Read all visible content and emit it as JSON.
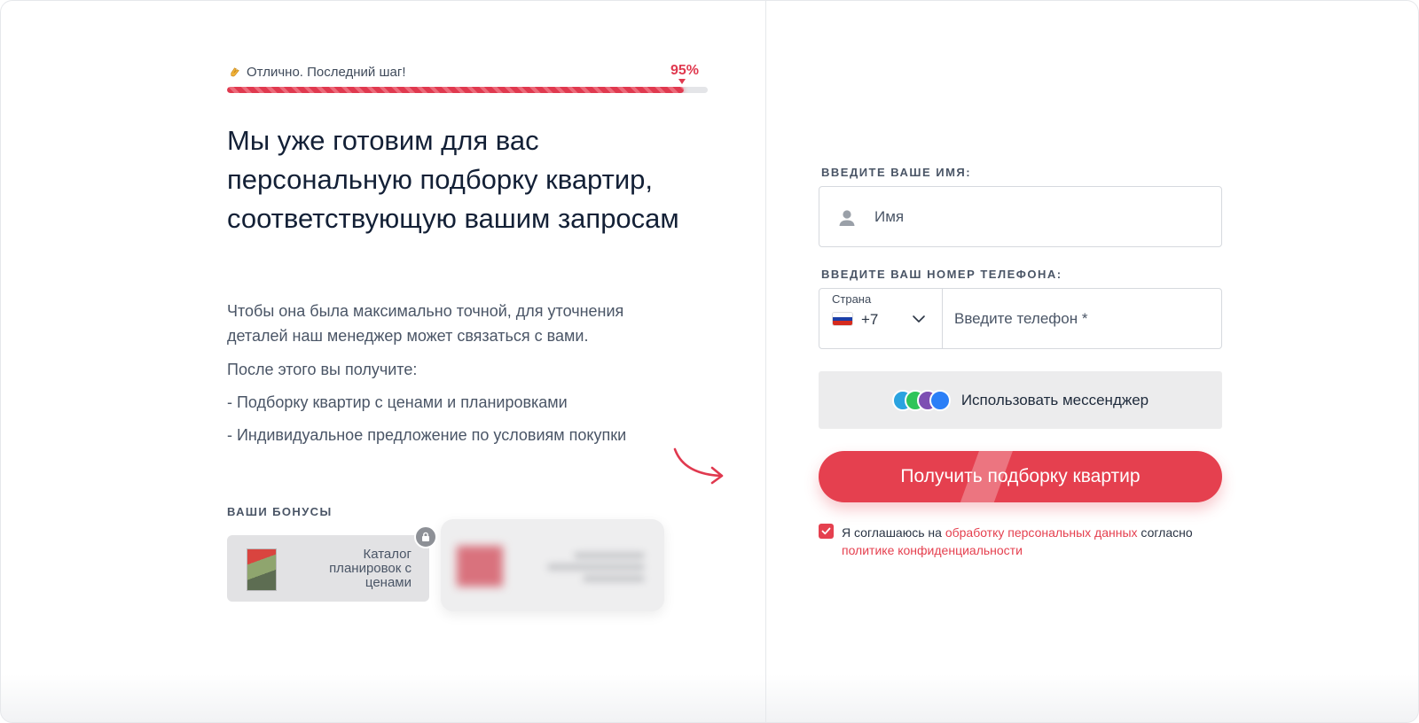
{
  "progress": {
    "text": "Отлично. Последний шаг!",
    "percent_label": "95%",
    "value": 0.95,
    "icon": "clap-icon"
  },
  "left": {
    "headline": "Мы уже готовим для вас персональную подборку квартир, соответствующую вашим запросам",
    "paragraph1": "Чтобы она была максимально точной, для уточнения деталей наш менеджер может связаться с вами.",
    "paragraph2": "После этого вы получите:",
    "bullet1": "- Подборку квартир с ценами и планировками",
    "bullet2": "- Индивидуальное предложение по условиям покупки",
    "bonuses_title": "ВАШИ БОНУСЫ",
    "bonus1_label": "Каталог планировок с ценами"
  },
  "form": {
    "name_label": "ВВЕДИТЕ ВАШЕ ИМЯ:",
    "name_placeholder": "Имя",
    "phone_label": "ВВЕДИТЕ ВАШ НОМЕР ТЕЛЕФОНА:",
    "country_label": "Страна",
    "country_code": "+7",
    "phone_placeholder": "Введите телефон *",
    "messenger_button": "Использовать мессенджер",
    "submit_button": "Получить подборку квартир",
    "consent_prefix": "Я соглашаюсь на",
    "consent_link1": "обработку персональных данных",
    "consent_middle": "согласно",
    "consent_link2": "политике конфиденциальности",
    "consent_checked": true
  },
  "colors": {
    "accent": "#e5404f",
    "text_dark": "#132036",
    "text_muted": "#4a5566"
  }
}
